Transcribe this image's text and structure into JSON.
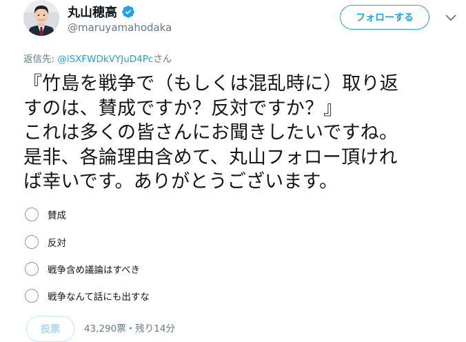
{
  "author": {
    "display_name": "丸山穂高",
    "handle": "@maruyamahodaka",
    "verified": true
  },
  "header": {
    "follow_label": "フォローする",
    "more_icon": "chevron-down-icon"
  },
  "reply": {
    "prefix": "返信先: ",
    "mention": "@iSXFWDkVYJuD4Pc",
    "suffix": "さん"
  },
  "tweet": {
    "text": "『竹島を戦争で（もしくは混乱時に）取り返\nすのは、賛成ですか？反対ですか？』\nこれは多くの皆さんにお聞きしたいですね。\n是非、各論理由含めて、丸山フォロー頂けれ\nば幸いです。ありがとうございます。"
  },
  "poll": {
    "options": [
      {
        "label": "賛成"
      },
      {
        "label": "反対"
      },
      {
        "label": "戦争含め議論はすべき"
      },
      {
        "label": "戦争なんて話にも出すな"
      }
    ],
    "vote_label": "投票",
    "status": "43,290票・残り14分"
  },
  "colors": {
    "accent": "#1da1f2",
    "secondary_text": "#657786",
    "primary_text": "#14171a",
    "disabled_button_text": "#a9d6f8"
  }
}
